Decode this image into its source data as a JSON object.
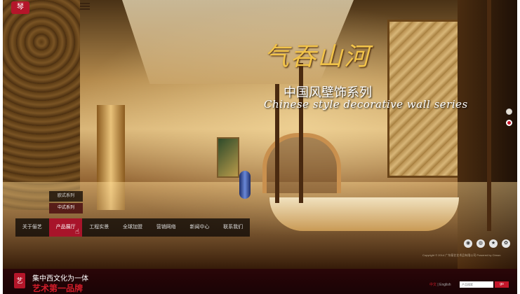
{
  "header": {
    "logo_text": "琴"
  },
  "banner": {
    "slogan_cn": "气吞山河",
    "slogan_sub": "中国风壁饰系列",
    "slogan_en": "Chinese style decorative wall series"
  },
  "slider": {
    "dots": 2,
    "active_index": 1
  },
  "submenu": {
    "items": [
      {
        "label": "欧式系列"
      },
      {
        "label": "中式系列"
      }
    ]
  },
  "nav": {
    "items": [
      {
        "label": "关于俪艺"
      },
      {
        "label": "产品展厅"
      },
      {
        "label": "工程实景"
      },
      {
        "label": "全球加盟"
      },
      {
        "label": "营销网络"
      },
      {
        "label": "新闻中心"
      },
      {
        "label": "联系我们"
      }
    ],
    "active_index": 1
  },
  "social": {
    "icons": [
      "weibo-icon",
      "wechat-icon",
      "qzone-icon",
      "paw-icon"
    ]
  },
  "copyright": "Copyright © 2014 广东俪艺艺术品有限公司 Powered by Ctmon",
  "footer": {
    "logo_text": "艺",
    "tagline1": "集中西文化为一体",
    "tagline2": "艺术第一品牌",
    "lang_cn": "中文",
    "lang_sep": "|",
    "lang_en": "English",
    "search_placeholder": "产品搜索",
    "search_button": "go"
  },
  "colors": {
    "accent": "#c3162a",
    "gold": "#f1c34a"
  }
}
